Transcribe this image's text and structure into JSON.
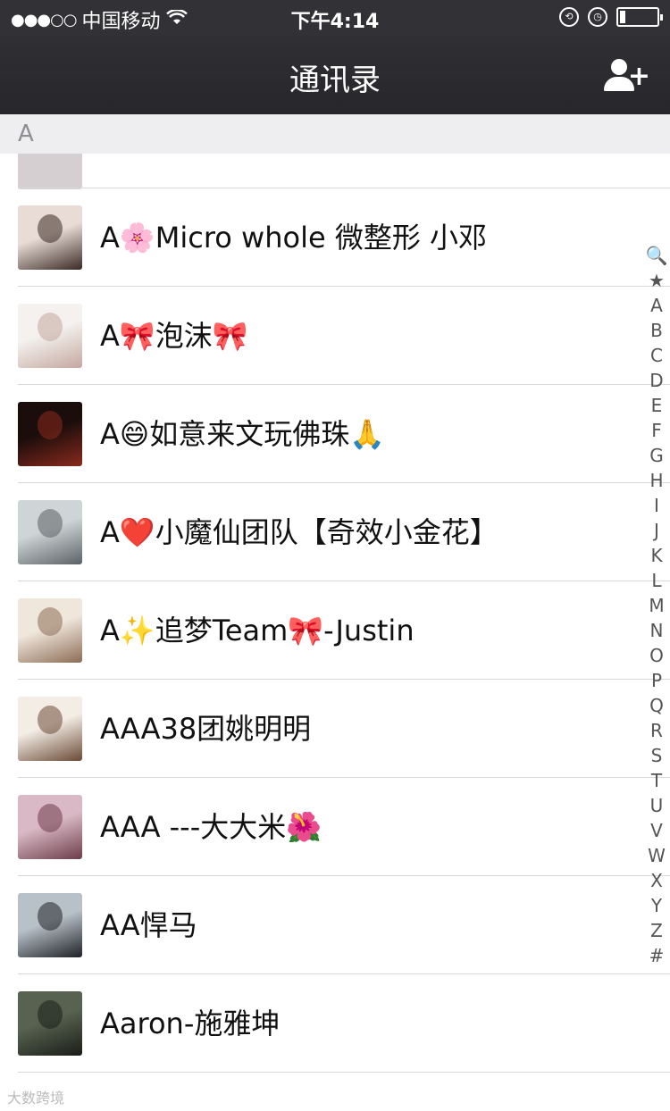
{
  "status": {
    "signal": "●●●○○",
    "carrier": "中国移动",
    "time": "下午4:14"
  },
  "nav": {
    "title": "通讯录"
  },
  "section": {
    "letter": "A"
  },
  "contacts": [
    {
      "name": "A🌸Micro whole 微整形 小邓",
      "avatar_colors": [
        "#e9dcd6",
        "#3a2a25"
      ]
    },
    {
      "name": "A🎀泡沫🎀",
      "avatar_colors": [
        "#f4f1ee",
        "#c4a8a0"
      ]
    },
    {
      "name": "A😄如意来文玩佛珠🙏",
      "avatar_colors": [
        "#1b0d0b",
        "#8a2a1d"
      ]
    },
    {
      "name": "A❤️小魔仙团队【奇效小金花】",
      "avatar_colors": [
        "#cfd5d6",
        "#5b6165"
      ]
    },
    {
      "name": "A✨追梦Team🎀-Justin",
      "avatar_colors": [
        "#efe6dc",
        "#8d6d55"
      ]
    },
    {
      "name": "AAA38团姚明明",
      "avatar_colors": [
        "#f3ede6",
        "#6b4a35"
      ]
    },
    {
      "name": "AAA ---大大米🌺",
      "avatar_colors": [
        "#d9b9c5",
        "#6d3d4a"
      ]
    },
    {
      "name": "AA悍马",
      "avatar_colors": [
        "#b8c0c8",
        "#1f2226"
      ]
    },
    {
      "name": "Aaron-施雅坤",
      "avatar_colors": [
        "#586250",
        "#1a1d18"
      ]
    }
  ],
  "index_letters": [
    "🔍",
    "★",
    "A",
    "B",
    "C",
    "D",
    "E",
    "F",
    "G",
    "H",
    "I",
    "J",
    "K",
    "L",
    "M",
    "N",
    "O",
    "P",
    "Q",
    "R",
    "S",
    "T",
    "U",
    "V",
    "W",
    "X",
    "Y",
    "Z",
    "#"
  ],
  "watermark": "大数跨境"
}
